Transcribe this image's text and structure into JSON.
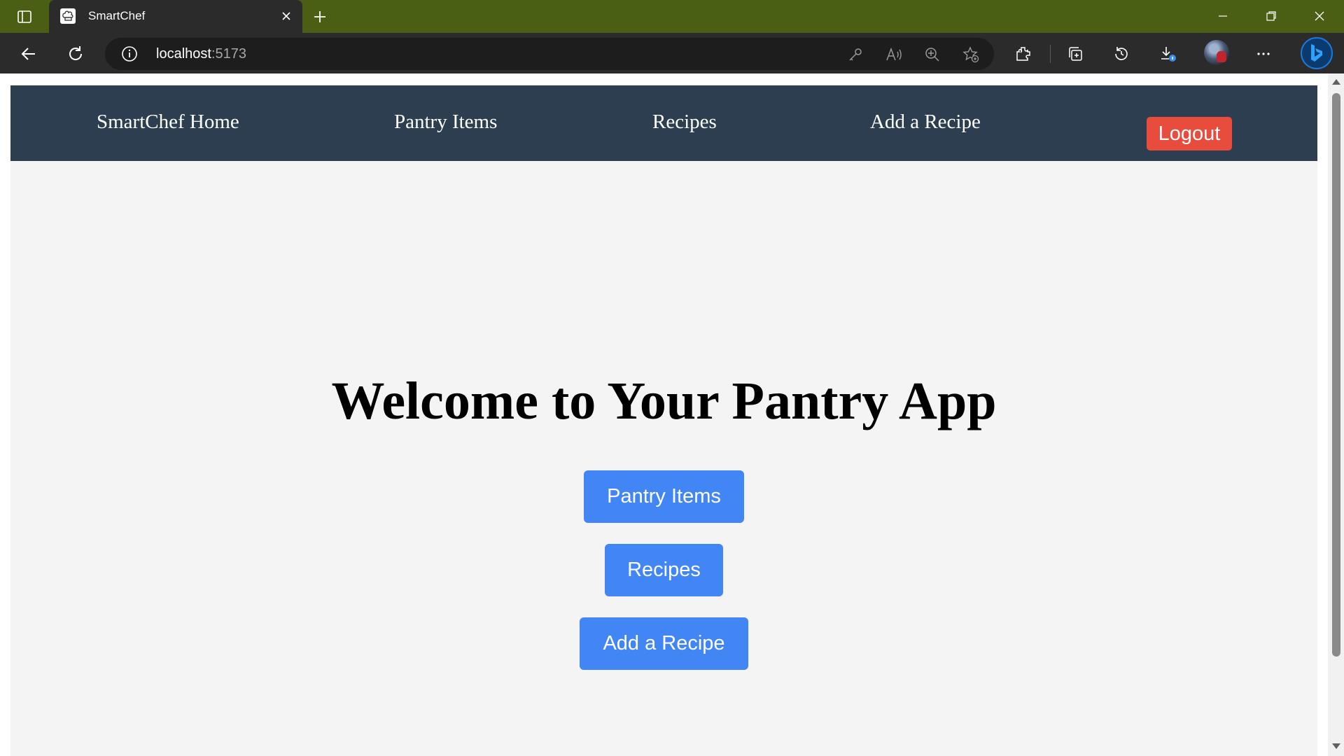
{
  "browser": {
    "tab": {
      "title": "SmartChef",
      "favicon": "chef-hat-icon"
    },
    "address": {
      "host": "localhost",
      "port": ":5173"
    },
    "colors": {
      "titlebar": "#4a5e14",
      "toolbar": "#2b2b2b"
    }
  },
  "app": {
    "navbar": {
      "links": [
        "SmartChef Home",
        "Pantry Items",
        "Recipes",
        "Add a Recipe"
      ],
      "logout_label": "Logout"
    },
    "hero": {
      "title": "Welcome to Your Pantry App",
      "buttons": [
        "Pantry Items",
        "Recipes",
        "Add a Recipe"
      ]
    },
    "colors": {
      "navbar_bg": "#2c3e50",
      "logout_bg": "#e74c3c",
      "cta_bg": "#4285f4",
      "page_bg": "#f4f4f4"
    }
  }
}
